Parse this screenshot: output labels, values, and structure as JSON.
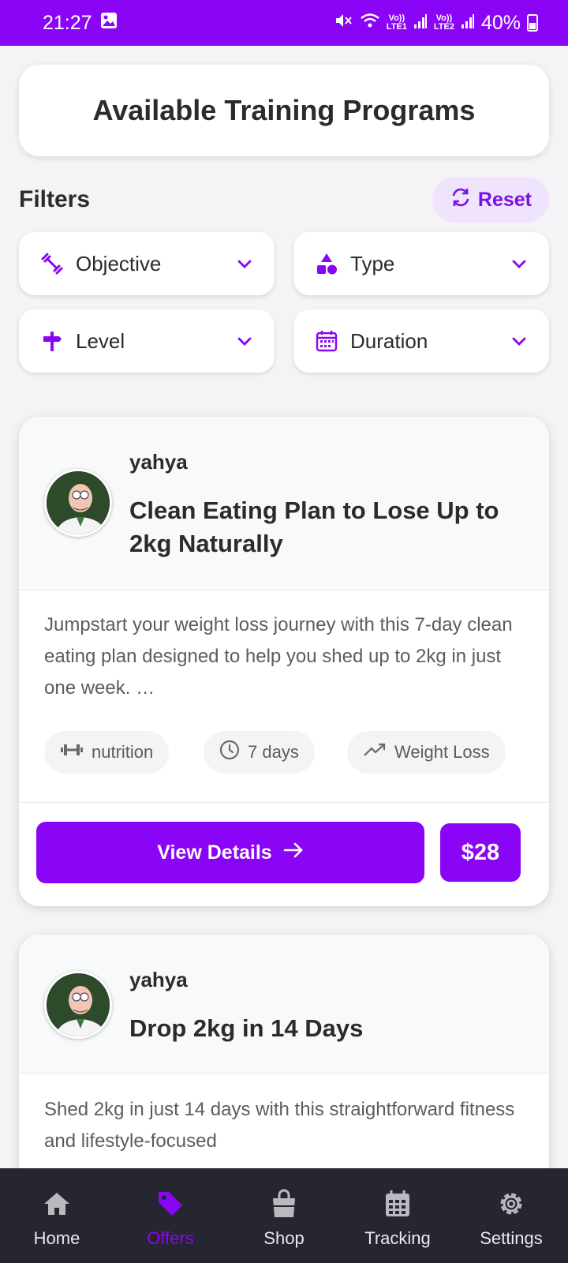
{
  "status_bar": {
    "time": "21:27",
    "sim1": "Vo))\nLTE1",
    "sim2": "Vo))\nLTE2",
    "battery": "40%"
  },
  "header": {
    "title": "Available Training Programs"
  },
  "filters": {
    "title": "Filters",
    "reset_label": "Reset",
    "items": [
      {
        "label": "Objective",
        "icon": "dumbbell-icon"
      },
      {
        "label": "Type",
        "icon": "shapes-icon"
      },
      {
        "label": "Level",
        "icon": "signpost-icon"
      },
      {
        "label": "Duration",
        "icon": "calendar-icon"
      }
    ]
  },
  "programs": [
    {
      "author": "yahya",
      "title": "Clean Eating Plan to Lose Up to 2kg Naturally",
      "description": "Jumpstart your weight loss journey with this 7-day clean eating plan designed to help you shed up to 2kg in just one week. …",
      "tags": [
        {
          "label": "nutrition",
          "icon": "dumbbell-icon"
        },
        {
          "label": "7 days",
          "icon": "clock-icon"
        },
        {
          "label": "Weight Loss",
          "icon": "trend-icon"
        }
      ],
      "view_label": "View Details",
      "price": "$28"
    },
    {
      "author": "yahya",
      "title": "Drop 2kg in 14 Days",
      "description": "Shed 2kg in just 14 days with this straightforward fitness and lifestyle-focused"
    }
  ],
  "nav": [
    {
      "label": "Home",
      "icon": "home-icon",
      "active": false
    },
    {
      "label": "Offers",
      "icon": "tag-icon",
      "active": true
    },
    {
      "label": "Shop",
      "icon": "shopping-bag-icon",
      "active": false
    },
    {
      "label": "Tracking",
      "icon": "calendar-icon",
      "active": false
    },
    {
      "label": "Settings",
      "icon": "gear-icon",
      "active": false
    }
  ],
  "colors": {
    "accent": "#8a05f5",
    "nav_bg": "#262630"
  }
}
